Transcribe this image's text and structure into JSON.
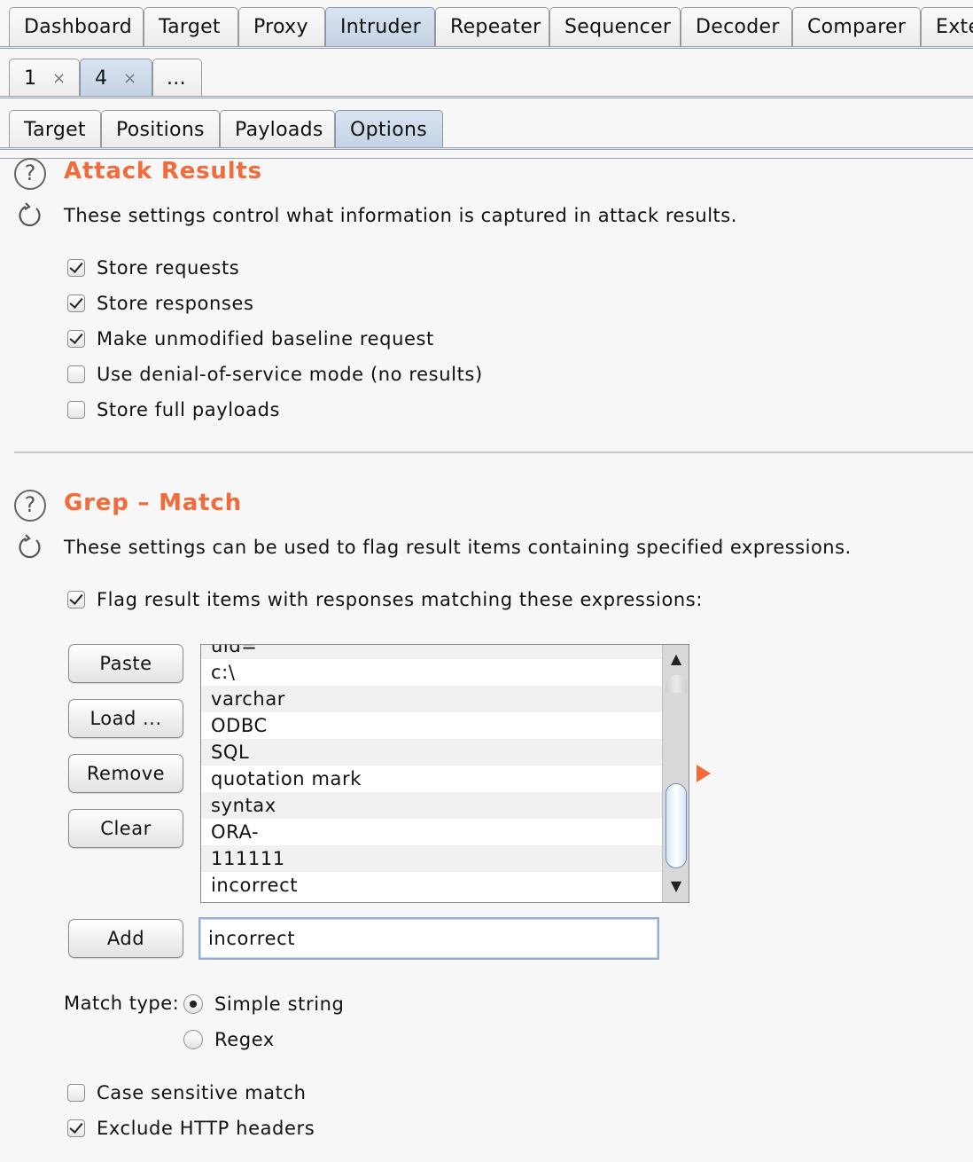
{
  "main_tabs": [
    {
      "label": "Dashboard",
      "active": false
    },
    {
      "label": "Target",
      "active": false
    },
    {
      "label": "Proxy",
      "active": false
    },
    {
      "label": "Intruder",
      "active": true
    },
    {
      "label": "Repeater",
      "active": false
    },
    {
      "label": "Sequencer",
      "active": false
    },
    {
      "label": "Decoder",
      "active": false
    },
    {
      "label": "Comparer",
      "active": false
    },
    {
      "label": "Exte",
      "active": false
    }
  ],
  "attack_tabs": [
    {
      "label": "1",
      "close": "×",
      "active": false
    },
    {
      "label": "4",
      "close": "×",
      "active": true
    },
    {
      "label": "...",
      "active": false
    }
  ],
  "sub_tabs": [
    {
      "label": "Target",
      "active": false
    },
    {
      "label": "Positions",
      "active": false
    },
    {
      "label": "Payloads",
      "active": false
    },
    {
      "label": "Options",
      "active": true
    }
  ],
  "icons": {
    "help": "?",
    "refresh": "refresh-icon",
    "expand": "orange-triangle-right-icon"
  },
  "colors": {
    "accent": "#f26b3a",
    "active_tab": "#c9d7e8"
  },
  "attack_results": {
    "title": "Attack Results",
    "description": "These settings control what information is captured in attack results.",
    "options": [
      {
        "label": "Store requests",
        "checked": true
      },
      {
        "label": "Store responses",
        "checked": true
      },
      {
        "label": "Make unmodified baseline request",
        "checked": true
      },
      {
        "label": "Use denial-of-service mode (no results)",
        "checked": false
      },
      {
        "label": "Store full payloads",
        "checked": false
      }
    ]
  },
  "grep_match": {
    "title": "Grep – Match",
    "description": "These settings can be used to flag result items containing specified expressions.",
    "flag_label": "Flag result items with responses matching these expressions:",
    "flag_checked": true,
    "buttons": {
      "paste": "Paste",
      "load": "Load ...",
      "remove": "Remove",
      "clear": "Clear",
      "add": "Add"
    },
    "expressions": [
      "uid=",
      "c:\\",
      "varchar",
      "ODBC",
      "SQL",
      "quotation mark",
      "syntax",
      "ORA-",
      "111111",
      "incorrect"
    ],
    "scroll_up": "▲",
    "scroll_down": "▼",
    "add_value": "incorrect",
    "match_type_label": "Match type:",
    "match_types": [
      {
        "label": "Simple string",
        "selected": true
      },
      {
        "label": "Regex",
        "selected": false
      }
    ],
    "case_sensitive": {
      "label": "Case sensitive match",
      "checked": false
    },
    "exclude_headers": {
      "label": "Exclude HTTP headers",
      "checked": true
    }
  }
}
